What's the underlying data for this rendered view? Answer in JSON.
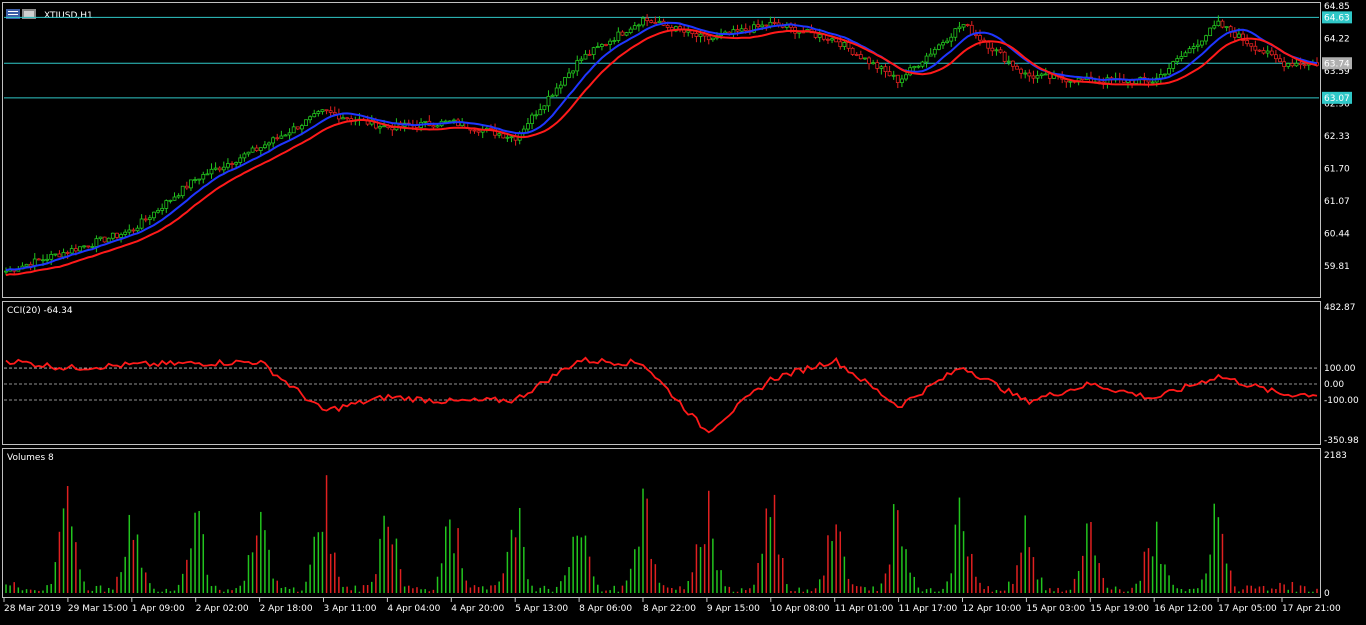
{
  "window": {
    "symbol_title": "XTIUSD,H1",
    "symbol_icon": "window-icon"
  },
  "colors": {
    "background": "#000000",
    "frame": "#c0c0c0",
    "bull": "#22c41e",
    "bear": "#e02020",
    "ma_blue": "#1f36ff",
    "ma_red": "#ff1a1a",
    "hline": "#2fc7c7",
    "cci": "#ff1a1a",
    "current_price_bg": "#b0b0b0",
    "hline_label_bg": "#2fc7c7",
    "text": "#ffffff"
  },
  "price_panel": {
    "axis_labels": [
      "64.85",
      "64.22",
      "63.59",
      "62.96",
      "62.33",
      "61.70",
      "61.07",
      "60.44",
      "59.81"
    ],
    "hlines": [
      {
        "value": 64.63,
        "label": "64.63"
      },
      {
        "value": 63.74,
        "label": "63.74"
      },
      {
        "value": 63.07,
        "label": "63.07"
      }
    ],
    "current_price": "63.74"
  },
  "cci_panel": {
    "title": "CCI(20) -64.34",
    "axis_labels": [
      "482.87",
      "100.00",
      "0.00",
      "-100.00",
      "-350.98"
    ],
    "levels": [
      100,
      0,
      -100
    ]
  },
  "volume_panel": {
    "title": "Volumes 8",
    "axis_labels": [
      "2183",
      "0"
    ]
  },
  "time_axis": {
    "labels": [
      "28 Mar 2019",
      "29 Mar 15:00",
      "1 Apr 09:00",
      "2 Apr 02:00",
      "2 Apr 18:00",
      "3 Apr 11:00",
      "4 Apr 04:00",
      "4 Apr 20:00",
      "5 Apr 13:00",
      "8 Apr 06:00",
      "8 Apr 22:00",
      "9 Apr 15:00",
      "10 Apr 08:00",
      "11 Apr 01:00",
      "11 Apr 17:00",
      "12 Apr 10:00",
      "15 Apr 03:00",
      "15 Apr 19:00",
      "16 Apr 12:00",
      "17 Apr 05:00",
      "17 Apr 21:00"
    ]
  },
  "chart_data": [
    {
      "type": "line",
      "title": "XTIUSD,H1",
      "ylim": [
        59.5,
        64.9
      ],
      "x": [
        "28 Mar 2019",
        "29 Mar 15:00",
        "1 Apr 09:00",
        "2 Apr 02:00",
        "2 Apr 18:00",
        "3 Apr 11:00",
        "4 Apr 04:00",
        "4 Apr 20:00",
        "5 Apr 13:00",
        "8 Apr 06:00",
        "8 Apr 22:00",
        "9 Apr 15:00",
        "10 Apr 08:00",
        "11 Apr 01:00",
        "11 Apr 17:00",
        "12 Apr 10:00",
        "15 Apr 03:00",
        "15 Apr 19:00",
        "16 Apr 12:00",
        "17 Apr 05:00",
        "17 Apr 21:00"
      ],
      "series": [
        {
          "values": [
            59.7,
            60.1,
            60.5,
            61.5,
            62.1,
            62.8,
            62.5,
            62.6,
            62.3,
            63.8,
            64.6,
            64.2,
            64.5,
            64.2,
            63.4,
            64.5,
            63.5,
            63.4,
            63.4,
            64.5,
            63.74
          ]
        }
      ]
    },
    {
      "type": "line",
      "title": "CCI(20) -64.34",
      "ylim": [
        -350.98,
        482.87
      ],
      "x": [
        "28 Mar 2019",
        "29 Mar 15:00",
        "1 Apr 09:00",
        "2 Apr 02:00",
        "2 Apr 18:00",
        "3 Apr 11:00",
        "4 Apr 04:00",
        "4 Apr 20:00",
        "5 Apr 13:00",
        "8 Apr 06:00",
        "8 Apr 22:00",
        "9 Apr 15:00",
        "10 Apr 08:00",
        "11 Apr 01:00",
        "11 Apr 17:00",
        "12 Apr 10:00",
        "15 Apr 03:00",
        "15 Apr 19:00",
        "16 Apr 12:00",
        "17 Apr 05:00",
        "17 Apr 21:00"
      ],
      "series": [
        {
          "values": [
            150,
            100,
            120,
            130,
            140,
            -170,
            -80,
            -110,
            -100,
            150,
            130,
            -300,
            30,
            150,
            -140,
            110,
            -110,
            0,
            -90,
            50,
            -64.34
          ]
        }
      ]
    },
    {
      "type": "bar",
      "title": "Volumes 8",
      "ylim": [
        0,
        2183
      ],
      "categories": [
        "28 Mar 2019",
        "29 Mar 15:00",
        "1 Apr 09:00",
        "2 Apr 02:00",
        "2 Apr 18:00",
        "3 Apr 11:00",
        "4 Apr 04:00",
        "4 Apr 20:00",
        "5 Apr 13:00",
        "8 Apr 06:00",
        "8 Apr 22:00",
        "9 Apr 15:00",
        "10 Apr 08:00",
        "11 Apr 01:00",
        "11 Apr 17:00",
        "12 Apr 10:00",
        "15 Apr 03:00",
        "15 Apr 19:00",
        "16 Apr 12:00",
        "17 Apr 05:00",
        "17 Apr 21:00"
      ],
      "values": [
        150,
        1800,
        1550,
        1600,
        1500,
        2150,
        1800,
        1500,
        1550,
        1550,
        1800,
        1850,
        1850,
        1700,
        1850,
        1650,
        1250,
        1250,
        1300,
        1550,
        150
      ]
    }
  ]
}
